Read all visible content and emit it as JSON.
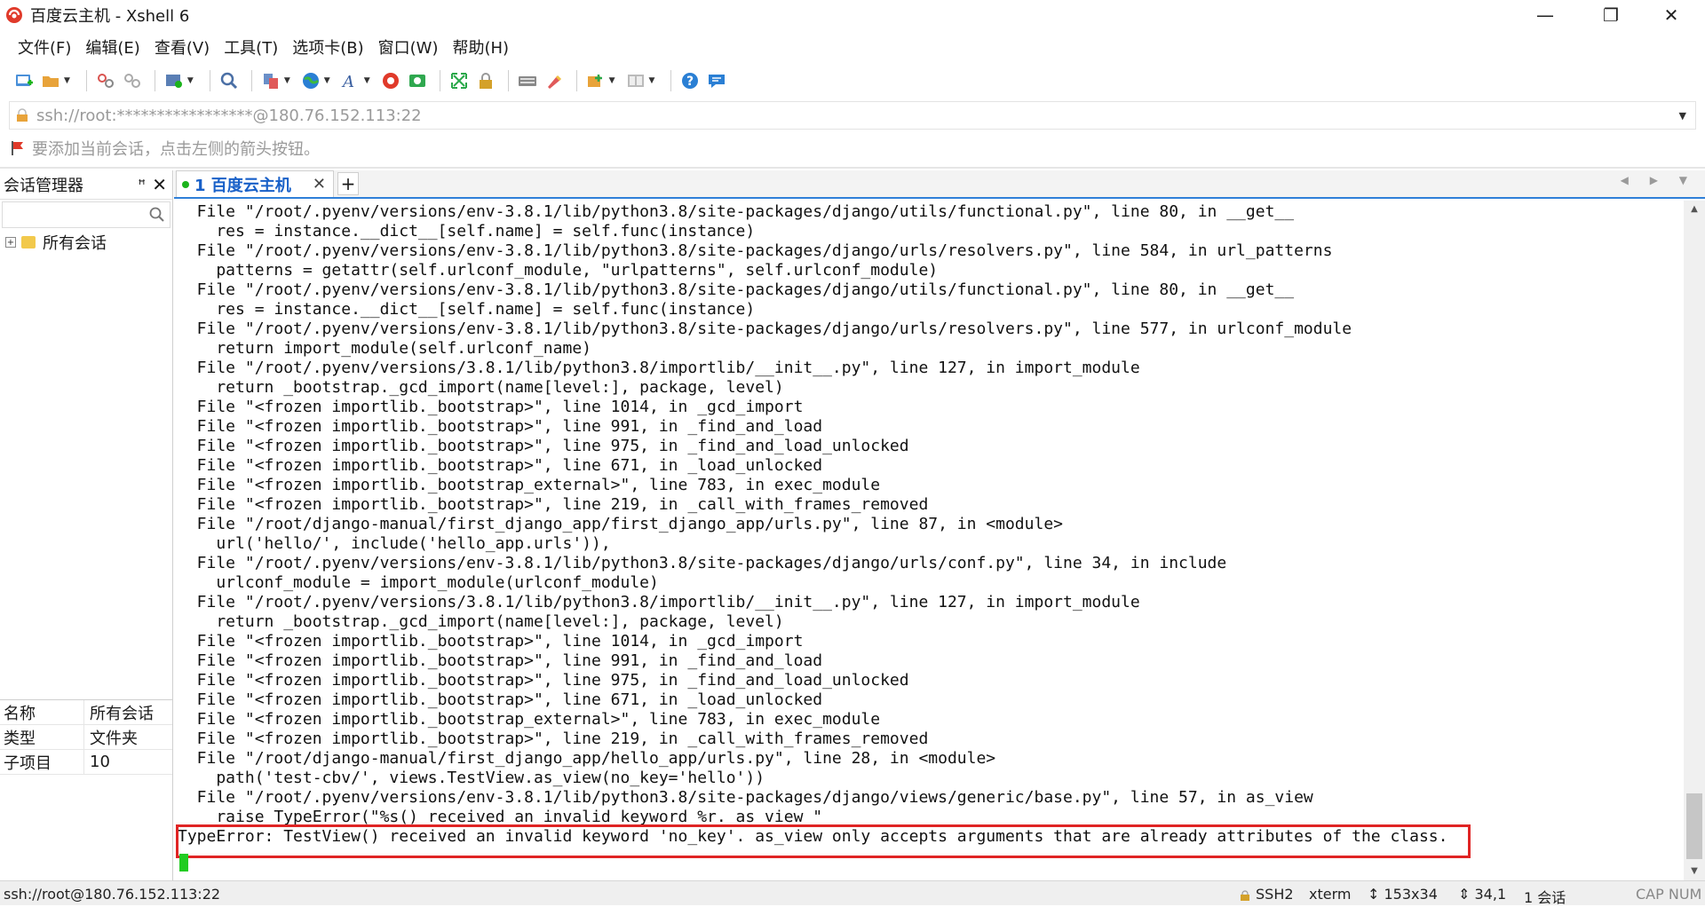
{
  "window": {
    "title": "百度云主机 - Xshell 6",
    "minimize_glyph": "—",
    "maximize_glyph": "❐",
    "close_glyph": "✕"
  },
  "menu": [
    "文件(F)",
    "编辑(E)",
    "查看(V)",
    "工具(T)",
    "选项卡(B)",
    "窗口(W)",
    "帮助(H)"
  ],
  "toolbar": {
    "icons": [
      "new-session-icon",
      "open-folder-icon",
      "connect-icon",
      "disconnect-icon",
      "properties-icon",
      "find-icon",
      "copy-paste-icon",
      "globe-icon",
      "font-icon",
      "xftp-icon",
      "xmanager-icon",
      "fullscreen-icon",
      "lock-icon",
      "keyboard-icon",
      "highlight-icon",
      "compose-icon",
      "layout-icon",
      "help-icon",
      "chat-icon"
    ]
  },
  "address": {
    "value": "ssh://root:*****************@180.76.152.113:22"
  },
  "hint": {
    "text": "要添加当前会话，点击左侧的箭头按钮。"
  },
  "session_manager": {
    "title": "会话管理器",
    "pin_glyph": "📌",
    "close_glyph": "✕",
    "tree_item": "所有会话",
    "properties": [
      {
        "key": "名称",
        "value": "所有会话"
      },
      {
        "key": "类型",
        "value": "文件夹"
      },
      {
        "key": "子项目",
        "value": "10"
      }
    ]
  },
  "tabs": {
    "active_label": "1 百度云主机",
    "close_glyph": "✕",
    "new_tab_glyph": "+",
    "nav_glyph": "◀ ▶ ▼"
  },
  "terminal": {
    "lines": [
      "  File \"/root/.pyenv/versions/env-3.8.1/lib/python3.8/site-packages/django/utils/functional.py\", line 80, in __get__",
      "    res = instance.__dict__[self.name] = self.func(instance)",
      "  File \"/root/.pyenv/versions/env-3.8.1/lib/python3.8/site-packages/django/urls/resolvers.py\", line 584, in url_patterns",
      "    patterns = getattr(self.urlconf_module, \"urlpatterns\", self.urlconf_module)",
      "  File \"/root/.pyenv/versions/env-3.8.1/lib/python3.8/site-packages/django/utils/functional.py\", line 80, in __get__",
      "    res = instance.__dict__[self.name] = self.func(instance)",
      "  File \"/root/.pyenv/versions/env-3.8.1/lib/python3.8/site-packages/django/urls/resolvers.py\", line 577, in urlconf_module",
      "    return import_module(self.urlconf_name)",
      "  File \"/root/.pyenv/versions/3.8.1/lib/python3.8/importlib/__init__.py\", line 127, in import_module",
      "    return _bootstrap._gcd_import(name[level:], package, level)",
      "  File \"<frozen importlib._bootstrap>\", line 1014, in _gcd_import",
      "  File \"<frozen importlib._bootstrap>\", line 991, in _find_and_load",
      "  File \"<frozen importlib._bootstrap>\", line 975, in _find_and_load_unlocked",
      "  File \"<frozen importlib._bootstrap>\", line 671, in _load_unlocked",
      "  File \"<frozen importlib._bootstrap_external>\", line 783, in exec_module",
      "  File \"<frozen importlib._bootstrap>\", line 219, in _call_with_frames_removed",
      "  File \"/root/django-manual/first_django_app/first_django_app/urls.py\", line 87, in <module>",
      "    url('hello/', include('hello_app.urls')),",
      "  File \"/root/.pyenv/versions/env-3.8.1/lib/python3.8/site-packages/django/urls/conf.py\", line 34, in include",
      "    urlconf_module = import_module(urlconf_module)",
      "  File \"/root/.pyenv/versions/3.8.1/lib/python3.8/importlib/__init__.py\", line 127, in import_module",
      "    return _bootstrap._gcd_import(name[level:], package, level)",
      "  File \"<frozen importlib._bootstrap>\", line 1014, in _gcd_import",
      "  File \"<frozen importlib._bootstrap>\", line 991, in _find_and_load",
      "  File \"<frozen importlib._bootstrap>\", line 975, in _find_and_load_unlocked",
      "  File \"<frozen importlib._bootstrap>\", line 671, in _load_unlocked",
      "  File \"<frozen importlib._bootstrap_external>\", line 783, in exec_module",
      "  File \"<frozen importlib._bootstrap>\", line 219, in _call_with_frames_removed",
      "  File \"/root/django-manual/first_django_app/hello_app/urls.py\", line 28, in <module>",
      "    path('test-cbv/', views.TestView.as_view(no_key='hello'))",
      "  File \"/root/.pyenv/versions/env-3.8.1/lib/python3.8/site-packages/django/views/generic/base.py\", line 57, in as_view",
      "    raise TypeError(\"%s() received an invalid keyword %r. as_view \"",
      "TypeError: TestView() received an invalid keyword 'no_key'. as_view only accepts arguments that are already attributes of the class."
    ],
    "cursor_color": "#22cc22",
    "highlight_color": "#e02424"
  },
  "statusbar": {
    "connection": "ssh://root@180.76.152.113:22",
    "protocol": "SSH2",
    "terminal_type": "xterm",
    "size": "153x34",
    "cursor_pos": "34,1",
    "sessions": "1 会话",
    "caps": "CAP NUM"
  },
  "colors": {
    "tab_accent": "#2f7fd8",
    "tab_label": "#1860c8",
    "active_dot": "#1bb31b"
  }
}
